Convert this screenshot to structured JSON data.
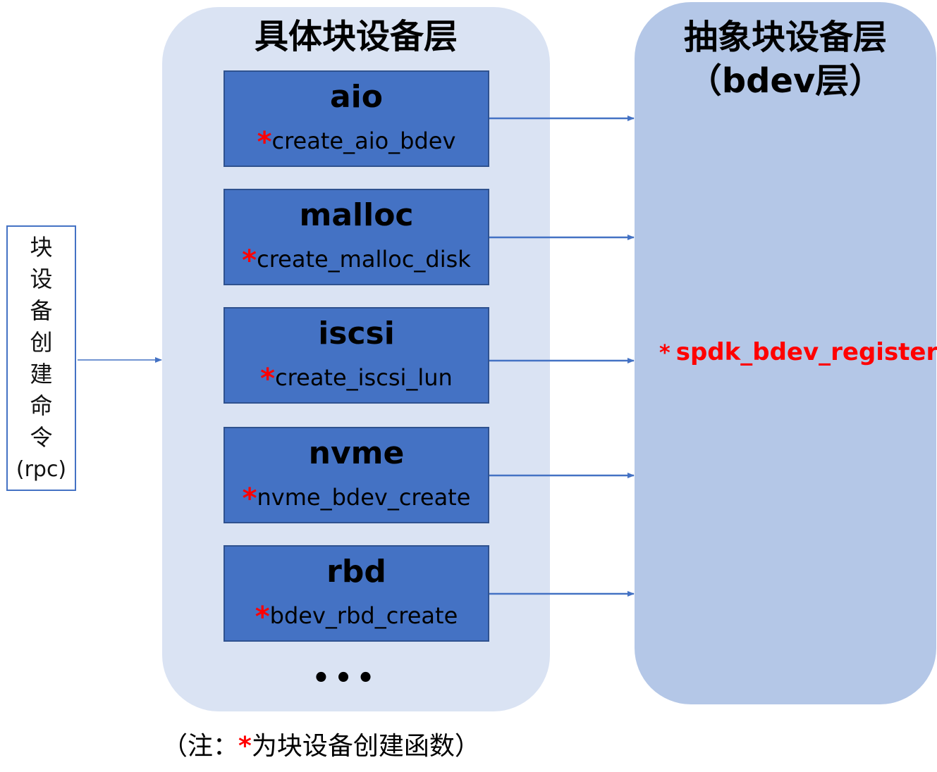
{
  "rpc_box": {
    "chars": [
      "块",
      "设",
      "备",
      "创",
      "建",
      "命",
      "令"
    ],
    "suffix": "(rpc)"
  },
  "concrete_layer": {
    "title": "具体块设备层",
    "modules": [
      {
        "name": "aio",
        "func": "create_aio_bdev"
      },
      {
        "name": "malloc",
        "func": "create_malloc_disk"
      },
      {
        "name": "iscsi",
        "func": "create_iscsi_lun"
      },
      {
        "name": "nvme",
        "func": "nvme_bdev_create"
      },
      {
        "name": "rbd",
        "func": "bdev_rbd_create"
      }
    ],
    "ellipsis": "•••"
  },
  "abstract_layer": {
    "title_line1": "抽象块设备层",
    "title_line2": "（bdev层）",
    "register_star": "*",
    "register_func": "spdk_bdev_register"
  },
  "marker_star": "*",
  "note": {
    "prefix": "（注：",
    "star": "*",
    "text": "为块设备创建函数）"
  },
  "colors": {
    "module_fill": "#4472c4",
    "concrete_bg": "#dae3f3",
    "abstract_bg": "#b4c7e7",
    "highlight": "#ff0000"
  }
}
